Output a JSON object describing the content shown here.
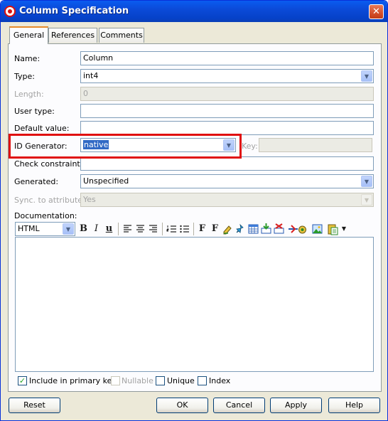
{
  "window": {
    "title": "Column Specification",
    "close_glyph": "✕"
  },
  "tabs": [
    {
      "label": "General",
      "active": true
    },
    {
      "label": "References",
      "active": false
    },
    {
      "label": "Comments",
      "active": false
    }
  ],
  "form": {
    "name": {
      "label": "Name:",
      "value": "Column"
    },
    "type": {
      "label": "Type:",
      "value": "int4"
    },
    "length": {
      "label": "Length:",
      "value": "0"
    },
    "user_type": {
      "label": "User type:",
      "value": ""
    },
    "default_value": {
      "label": "Default value:",
      "value": ""
    },
    "id_generator": {
      "label": "ID Generator:",
      "value": "native"
    },
    "key": {
      "label": "Key:",
      "value": ""
    },
    "check_constraint": {
      "label": "Check constraint:",
      "value": ""
    },
    "generated": {
      "label": "Generated:",
      "value": "Unspecified"
    },
    "sync": {
      "label": "Sync. to attribute:",
      "value": "Yes"
    },
    "documentation": {
      "label": "Documentation:",
      "format": "HTML"
    }
  },
  "toolbar": {
    "bold": "B",
    "italic": "I",
    "underline": "u",
    "font": "F",
    "font_size": "F",
    "icons": [
      "align-left-icon",
      "align-center-icon",
      "align-right-icon",
      "ordered-list-icon",
      "unordered-list-icon",
      "font-icon",
      "font-size-icon",
      "highlight-icon",
      "link-icon",
      "table-icon",
      "insert-icon",
      "remove-icon",
      "anchor-icon",
      "image-icon",
      "paste-icon"
    ]
  },
  "checkboxes": {
    "primary_key": {
      "label": "Include in primary key",
      "checked": true
    },
    "nullable": {
      "label": "Nullable",
      "checked": false,
      "disabled": true
    },
    "unique": {
      "label": "Unique",
      "checked": false
    },
    "index": {
      "label": "Index",
      "checked": false
    }
  },
  "buttons": {
    "reset": "Reset",
    "ok": "OK",
    "cancel": "Cancel",
    "apply": "Apply",
    "help": "Help"
  },
  "colors": {
    "title_bar": "#0a5cf0",
    "highlight": "#e01010",
    "selection": "#316ac5"
  }
}
